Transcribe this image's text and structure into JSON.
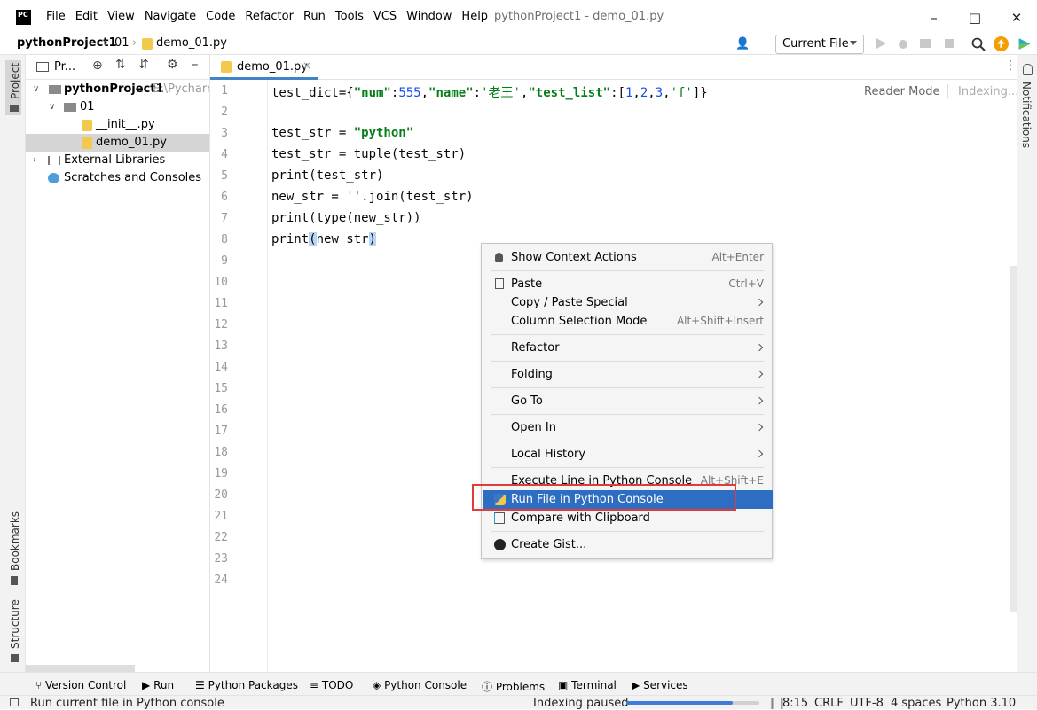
{
  "app": {
    "logo": "PC",
    "window_title": "pythonProject1 - demo_01.py"
  },
  "menu": [
    "File",
    "Edit",
    "View",
    "Navigate",
    "Code",
    "Refactor",
    "Run",
    "Tools",
    "VCS",
    "Window",
    "Help"
  ],
  "navbar": {
    "crumbs": [
      "pythonProject1",
      "01",
      "demo_01.py"
    ],
    "run_config": "Current File"
  },
  "project_panel": {
    "title": "Pr...",
    "tree": [
      {
        "label": "pythonProject1",
        "path": "E:\\Pycharm"
      },
      {
        "label": "01"
      },
      {
        "label": "__init__.py"
      },
      {
        "label": "demo_01.py"
      },
      {
        "label": "External Libraries"
      },
      {
        "label": "Scratches and Consoles"
      }
    ]
  },
  "left_stripe": {
    "project": "Project",
    "bookmarks": "Bookmarks",
    "structure": "Structure"
  },
  "right_stripe": {
    "notifications": "Notifications"
  },
  "editor": {
    "tab": "demo_01.py",
    "reader_mode": "Reader Mode",
    "indexing": "Indexing...",
    "line_numbers": [
      "1",
      "2",
      "3",
      "4",
      "5",
      "6",
      "7",
      "8",
      "9",
      "10",
      "11",
      "12",
      "13",
      "14",
      "15",
      "16",
      "17",
      "18",
      "19",
      "20",
      "21",
      "22",
      "23",
      "24"
    ]
  },
  "context_menu": [
    {
      "label": "Show Context Actions",
      "shortcut": "Alt+Enter",
      "icon": "bulb-icon"
    },
    {
      "label": "Paste",
      "shortcut": "Ctrl+V",
      "icon": "clipboard-icon"
    },
    {
      "label": "Copy / Paste Special",
      "submenu": true
    },
    {
      "label": "Column Selection Mode",
      "shortcut": "Alt+Shift+Insert"
    },
    {
      "label": "Refactor",
      "submenu": true
    },
    {
      "label": "Folding",
      "submenu": true
    },
    {
      "label": "Go To",
      "submenu": true
    },
    {
      "label": "Open In",
      "submenu": true
    },
    {
      "label": "Local History",
      "submenu": true
    },
    {
      "label": "Execute Line in Python Console",
      "shortcut": "Alt+Shift+E"
    },
    {
      "label": "Run File in Python Console",
      "highlighted": true,
      "icon": "python-icon"
    },
    {
      "label": "Compare with Clipboard",
      "icon": "compare-icon"
    },
    {
      "label": "Create Gist...",
      "icon": "github-icon"
    }
  ],
  "bottom_tools": [
    "Version Control",
    "Run",
    "Python Packages",
    "TODO",
    "Python Console",
    "Problems",
    "Terminal",
    "Services"
  ],
  "status": {
    "message": "Run current file in Python console",
    "indexing": "Indexing paused",
    "position": "8:15",
    "line_sep": "CRLF",
    "encoding": "UTF-8",
    "indent": "4 spaces",
    "interpreter": "Python 3.10"
  },
  "colors": {
    "accent": "#2e6ec2",
    "highlight_box": "#e03c3c",
    "string": "#067d17",
    "number": "#1750eb"
  }
}
